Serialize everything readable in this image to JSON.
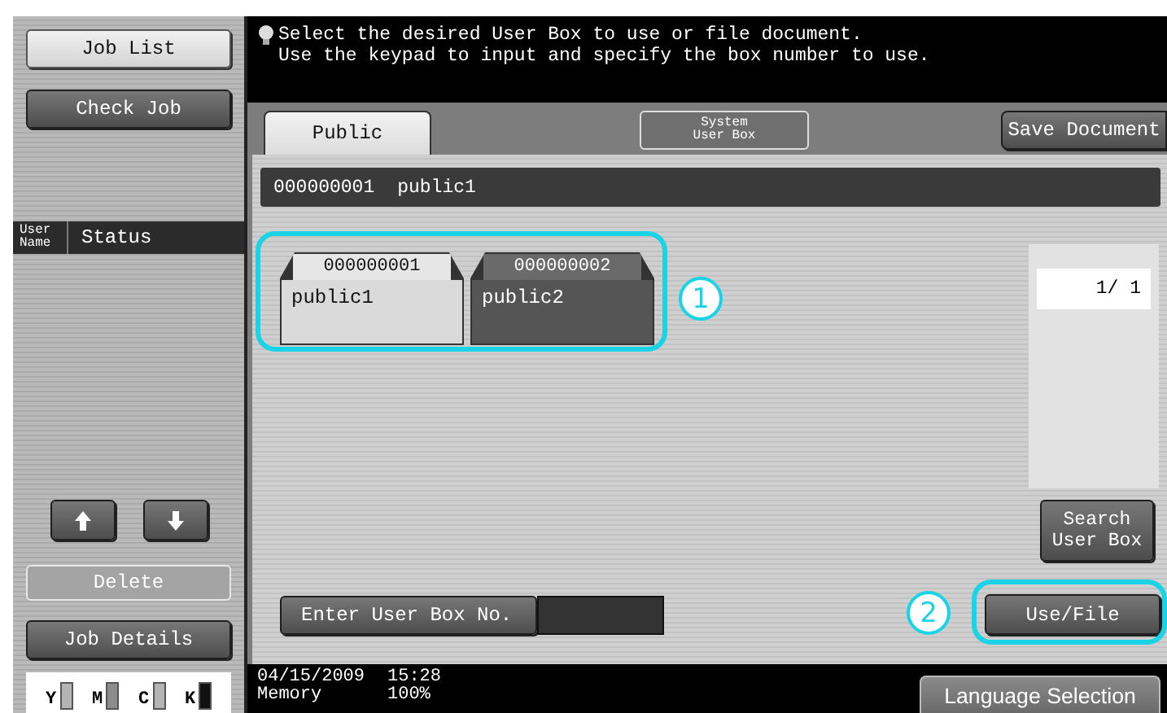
{
  "sidebar": {
    "top_buttons": [
      {
        "label": "Job List",
        "kind": "light",
        "disabled": false
      },
      {
        "label": "Check Job",
        "kind": "dark",
        "disabled": false
      }
    ],
    "job_table": {
      "columns": [
        "User Name",
        "Status"
      ]
    },
    "bottom_buttons": [
      {
        "label": "Delete",
        "kind": "light",
        "disabled": true
      },
      {
        "label": "Job Details",
        "kind": "dark",
        "disabled": false
      }
    ],
    "toner": [
      {
        "label": "Y",
        "color": "#b4b4b4"
      },
      {
        "label": "M",
        "color": "#8c8c8c"
      },
      {
        "label": "C",
        "color": "#b4b4b4"
      },
      {
        "label": "K",
        "color": "#111111"
      }
    ]
  },
  "message": [
    "Select the desired User Box to use or file document.",
    "Use the keypad to input and specify the box number to use."
  ],
  "tabs": [
    {
      "label": "Public",
      "selected": true
    },
    {
      "label": "System User Box",
      "selected": false
    }
  ],
  "save_document_button": "Save Document",
  "current_box": {
    "number": "000000001",
    "name": "public1"
  },
  "boxes": [
    {
      "number": "000000001",
      "name": "public1",
      "selected": true
    },
    {
      "number": "000000002",
      "name": "public2",
      "selected": false
    }
  ],
  "page_indicator": "1/ 1",
  "search_button": "Search User Box",
  "box_number_entry": {
    "label": "Enter User Box No."
  },
  "use_file_button": "Use/File",
  "callouts": [
    "1",
    "2"
  ],
  "status_bar": {
    "date": "04/15/2009",
    "time": "15:28",
    "memory_label": "Memory",
    "memory_value": "100%"
  },
  "language_button": "Language Selection"
}
